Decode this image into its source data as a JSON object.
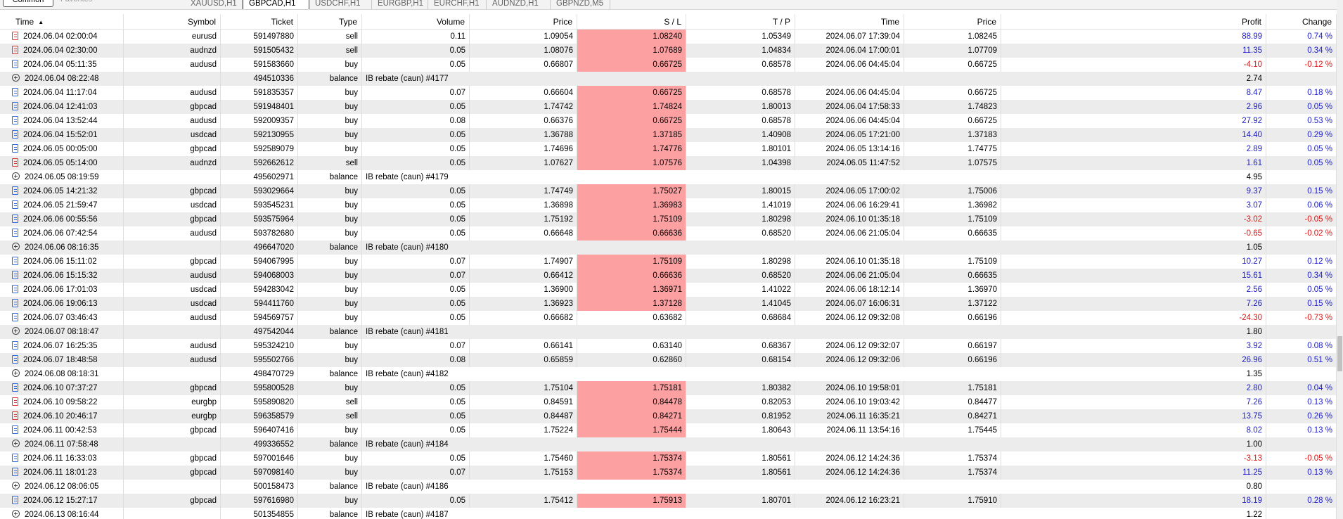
{
  "tabs": {
    "common": "Common",
    "favorites": "Favorites",
    "charts": [
      "XAUUSD,H1",
      "GBPCAD,H1",
      "USDCHF,H1",
      "EURGBP,H1",
      "EURCHF,H1",
      "AUDNZD,H1",
      "GBPNZD,M5"
    ],
    "active_index": 1
  },
  "columns": [
    "Time",
    "Symbol",
    "Ticket",
    "Type",
    "Volume",
    "Price",
    "S / L",
    "T / P",
    "Time",
    "Price",
    "Profit",
    "Change"
  ],
  "colors": {
    "sl_highlight": "#fca0a2",
    "positive": "#1a1acf",
    "negative": "#e01414",
    "stripe": "#ececec"
  },
  "rows": [
    {
      "kind": "sell",
      "time": "2024.06.04 02:00:04",
      "symbol": "eurusd",
      "ticket": "591497880",
      "type": "sell",
      "volume": "0.11",
      "price": "1.09054",
      "sl": "1.08240",
      "sl_hit": true,
      "tp": "1.05349",
      "close_time": "2024.06.07 17:39:04",
      "close_price": "1.08245",
      "profit": "88.99",
      "change": "0.74 %"
    },
    {
      "kind": "sell",
      "time": "2024.06.04 02:30:00",
      "symbol": "audnzd",
      "ticket": "591505432",
      "type": "sell",
      "volume": "0.05",
      "price": "1.08076",
      "sl": "1.07689",
      "sl_hit": true,
      "tp": "1.04834",
      "close_time": "2024.06.04 17:00:01",
      "close_price": "1.07709",
      "profit": "11.35",
      "change": "0.34 %"
    },
    {
      "kind": "buy",
      "time": "2024.06.04 05:11:35",
      "symbol": "audusd",
      "ticket": "591583660",
      "type": "buy",
      "volume": "0.05",
      "price": "0.66807",
      "sl": "0.66725",
      "sl_hit": true,
      "tp": "0.68578",
      "close_time": "2024.06.06 04:45:04",
      "close_price": "0.66725",
      "profit": "-4.10",
      "change": "-0.12 %"
    },
    {
      "kind": "balance",
      "time": "2024.06.04 08:22:48",
      "ticket": "494510336",
      "type": "balance",
      "comment": "IB rebate (caun) #4177",
      "profit": "2.74"
    },
    {
      "kind": "buy",
      "time": "2024.06.04 11:17:04",
      "symbol": "audusd",
      "ticket": "591835357",
      "type": "buy",
      "volume": "0.07",
      "price": "0.66604",
      "sl": "0.66725",
      "sl_hit": true,
      "tp": "0.68578",
      "close_time": "2024.06.06 04:45:04",
      "close_price": "0.66725",
      "profit": "8.47",
      "change": "0.18 %"
    },
    {
      "kind": "buy",
      "time": "2024.06.04 12:41:03",
      "symbol": "gbpcad",
      "ticket": "591948401",
      "type": "buy",
      "volume": "0.05",
      "price": "1.74742",
      "sl": "1.74824",
      "sl_hit": true,
      "tp": "1.80013",
      "close_time": "2024.06.04 17:58:33",
      "close_price": "1.74823",
      "profit": "2.96",
      "change": "0.05 %"
    },
    {
      "kind": "buy",
      "time": "2024.06.04 13:52:44",
      "symbol": "audusd",
      "ticket": "592009357",
      "type": "buy",
      "volume": "0.08",
      "price": "0.66376",
      "sl": "0.66725",
      "sl_hit": true,
      "tp": "0.68578",
      "close_time": "2024.06.06 04:45:04",
      "close_price": "0.66725",
      "profit": "27.92",
      "change": "0.53 %"
    },
    {
      "kind": "buy",
      "time": "2024.06.04 15:52:01",
      "symbol": "usdcad",
      "ticket": "592130955",
      "type": "buy",
      "volume": "0.05",
      "price": "1.36788",
      "sl": "1.37185",
      "sl_hit": true,
      "tp": "1.40908",
      "close_time": "2024.06.05 17:21:00",
      "close_price": "1.37183",
      "profit": "14.40",
      "change": "0.29 %"
    },
    {
      "kind": "buy",
      "time": "2024.06.05 00:05:00",
      "symbol": "gbpcad",
      "ticket": "592589079",
      "type": "buy",
      "volume": "0.05",
      "price": "1.74696",
      "sl": "1.74776",
      "sl_hit": true,
      "tp": "1.80101",
      "close_time": "2024.06.05 13:14:16",
      "close_price": "1.74775",
      "profit": "2.89",
      "change": "0.05 %"
    },
    {
      "kind": "sell",
      "time": "2024.06.05 05:14:00",
      "symbol": "audnzd",
      "ticket": "592662612",
      "type": "sell",
      "volume": "0.05",
      "price": "1.07627",
      "sl": "1.07576",
      "sl_hit": true,
      "tp": "1.04398",
      "close_time": "2024.06.05 11:47:52",
      "close_price": "1.07575",
      "profit": "1.61",
      "change": "0.05 %"
    },
    {
      "kind": "balance",
      "time": "2024.06.05 08:19:59",
      "ticket": "495602971",
      "type": "balance",
      "comment": "IB rebate (caun) #4179",
      "profit": "4.95"
    },
    {
      "kind": "buy",
      "time": "2024.06.05 14:21:32",
      "symbol": "gbpcad",
      "ticket": "593029664",
      "type": "buy",
      "volume": "0.05",
      "price": "1.74749",
      "sl": "1.75027",
      "sl_hit": true,
      "tp": "1.80015",
      "close_time": "2024.06.05 17:00:02",
      "close_price": "1.75006",
      "profit": "9.37",
      "change": "0.15 %"
    },
    {
      "kind": "buy",
      "time": "2024.06.05 21:59:47",
      "symbol": "usdcad",
      "ticket": "593545231",
      "type": "buy",
      "volume": "0.05",
      "price": "1.36898",
      "sl": "1.36983",
      "sl_hit": true,
      "tp": "1.41019",
      "close_time": "2024.06.06 16:29:41",
      "close_price": "1.36982",
      "profit": "3.07",
      "change": "0.06 %"
    },
    {
      "kind": "buy",
      "time": "2024.06.06 00:55:56",
      "symbol": "gbpcad",
      "ticket": "593575964",
      "type": "buy",
      "volume": "0.05",
      "price": "1.75192",
      "sl": "1.75109",
      "sl_hit": true,
      "tp": "1.80298",
      "close_time": "2024.06.10 01:35:18",
      "close_price": "1.75109",
      "profit": "-3.02",
      "change": "-0.05 %"
    },
    {
      "kind": "buy",
      "time": "2024.06.06 07:42:54",
      "symbol": "audusd",
      "ticket": "593782680",
      "type": "buy",
      "volume": "0.05",
      "price": "0.66648",
      "sl": "0.66636",
      "sl_hit": true,
      "tp": "0.68520",
      "close_time": "2024.06.06 21:05:04",
      "close_price": "0.66635",
      "profit": "-0.65",
      "change": "-0.02 %"
    },
    {
      "kind": "balance",
      "time": "2024.06.06 08:16:35",
      "ticket": "496647020",
      "type": "balance",
      "comment": "IB rebate (caun) #4180",
      "profit": "1.05"
    },
    {
      "kind": "buy",
      "time": "2024.06.06 15:11:02",
      "symbol": "gbpcad",
      "ticket": "594067995",
      "type": "buy",
      "volume": "0.07",
      "price": "1.74907",
      "sl": "1.75109",
      "sl_hit": true,
      "tp": "1.80298",
      "close_time": "2024.06.10 01:35:18",
      "close_price": "1.75109",
      "profit": "10.27",
      "change": "0.12 %"
    },
    {
      "kind": "buy",
      "time": "2024.06.06 15:15:32",
      "symbol": "audusd",
      "ticket": "594068003",
      "type": "buy",
      "volume": "0.07",
      "price": "0.66412",
      "sl": "0.66636",
      "sl_hit": true,
      "tp": "0.68520",
      "close_time": "2024.06.06 21:05:04",
      "close_price": "0.66635",
      "profit": "15.61",
      "change": "0.34 %"
    },
    {
      "kind": "buy",
      "time": "2024.06.06 17:01:03",
      "symbol": "usdcad",
      "ticket": "594283042",
      "type": "buy",
      "volume": "0.05",
      "price": "1.36900",
      "sl": "1.36971",
      "sl_hit": true,
      "tp": "1.41022",
      "close_time": "2024.06.06 18:12:14",
      "close_price": "1.36970",
      "profit": "2.56",
      "change": "0.05 %"
    },
    {
      "kind": "buy",
      "time": "2024.06.06 19:06:13",
      "symbol": "usdcad",
      "ticket": "594411760",
      "type": "buy",
      "volume": "0.05",
      "price": "1.36923",
      "sl": "1.37128",
      "sl_hit": true,
      "tp": "1.41045",
      "close_time": "2024.06.07 16:06:31",
      "close_price": "1.37122",
      "profit": "7.26",
      "change": "0.15 %"
    },
    {
      "kind": "buy",
      "time": "2024.06.07 03:46:43",
      "symbol": "audusd",
      "ticket": "594569757",
      "type": "buy",
      "volume": "0.05",
      "price": "0.66682",
      "sl": "0.63682",
      "sl_hit": false,
      "tp": "0.68684",
      "close_time": "2024.06.12 09:32:08",
      "close_price": "0.66196",
      "profit": "-24.30",
      "change": "-0.73 %"
    },
    {
      "kind": "balance",
      "time": "2024.06.07 08:18:47",
      "ticket": "497542044",
      "type": "balance",
      "comment": "IB rebate (caun) #4181",
      "profit": "1.80"
    },
    {
      "kind": "buy",
      "time": "2024.06.07 16:25:35",
      "symbol": "audusd",
      "ticket": "595324210",
      "type": "buy",
      "volume": "0.07",
      "price": "0.66141",
      "sl": "0.63140",
      "sl_hit": false,
      "tp": "0.68367",
      "close_time": "2024.06.12 09:32:07",
      "close_price": "0.66197",
      "profit": "3.92",
      "change": "0.08 %"
    },
    {
      "kind": "buy",
      "time": "2024.06.07 18:48:58",
      "symbol": "audusd",
      "ticket": "595502766",
      "type": "buy",
      "volume": "0.08",
      "price": "0.65859",
      "sl": "0.62860",
      "sl_hit": false,
      "tp": "0.68154",
      "close_time": "2024.06.12 09:32:06",
      "close_price": "0.66196",
      "profit": "26.96",
      "change": "0.51 %"
    },
    {
      "kind": "balance",
      "time": "2024.06.08 08:18:31",
      "ticket": "498470729",
      "type": "balance",
      "comment": "IB rebate (caun) #4182",
      "profit": "1.35"
    },
    {
      "kind": "buy",
      "time": "2024.06.10 07:37:27",
      "symbol": "gbpcad",
      "ticket": "595800528",
      "type": "buy",
      "volume": "0.05",
      "price": "1.75104",
      "sl": "1.75181",
      "sl_hit": true,
      "tp": "1.80382",
      "close_time": "2024.06.10 19:58:01",
      "close_price": "1.75181",
      "profit": "2.80",
      "change": "0.04 %"
    },
    {
      "kind": "sell",
      "time": "2024.06.10 09:58:22",
      "symbol": "eurgbp",
      "ticket": "595890820",
      "type": "sell",
      "volume": "0.05",
      "price": "0.84591",
      "sl": "0.84478",
      "sl_hit": true,
      "tp": "0.82053",
      "close_time": "2024.06.10 19:03:42",
      "close_price": "0.84477",
      "profit": "7.26",
      "change": "0.13 %"
    },
    {
      "kind": "sell",
      "time": "2024.06.10 20:46:17",
      "symbol": "eurgbp",
      "ticket": "596358579",
      "type": "sell",
      "volume": "0.05",
      "price": "0.84487",
      "sl": "0.84271",
      "sl_hit": true,
      "tp": "0.81952",
      "close_time": "2024.06.11 16:35:21",
      "close_price": "0.84271",
      "profit": "13.75",
      "change": "0.26 %"
    },
    {
      "kind": "buy",
      "time": "2024.06.11 00:42:53",
      "symbol": "gbpcad",
      "ticket": "596407416",
      "type": "buy",
      "volume": "0.05",
      "price": "1.75224",
      "sl": "1.75444",
      "sl_hit": true,
      "tp": "1.80643",
      "close_time": "2024.06.11 13:54:16",
      "close_price": "1.75445",
      "profit": "8.02",
      "change": "0.13 %"
    },
    {
      "kind": "balance",
      "time": "2024.06.11 07:58:48",
      "ticket": "499336552",
      "type": "balance",
      "comment": "IB rebate (caun) #4184",
      "profit": "1.00"
    },
    {
      "kind": "buy",
      "time": "2024.06.11 16:33:03",
      "symbol": "gbpcad",
      "ticket": "597001646",
      "type": "buy",
      "volume": "0.05",
      "price": "1.75460",
      "sl": "1.75374",
      "sl_hit": true,
      "tp": "1.80561",
      "close_time": "2024.06.12 14:24:36",
      "close_price": "1.75374",
      "profit": "-3.13",
      "change": "-0.05 %"
    },
    {
      "kind": "buy",
      "time": "2024.06.11 18:01:23",
      "symbol": "gbpcad",
      "ticket": "597098140",
      "type": "buy",
      "volume": "0.07",
      "price": "1.75153",
      "sl": "1.75374",
      "sl_hit": true,
      "tp": "1.80561",
      "close_time": "2024.06.12 14:24:36",
      "close_price": "1.75374",
      "profit": "11.25",
      "change": "0.13 %"
    },
    {
      "kind": "balance",
      "time": "2024.06.12 08:06:05",
      "ticket": "500158473",
      "type": "balance",
      "comment": "IB rebate (caun) #4186",
      "profit": "0.80"
    },
    {
      "kind": "buy",
      "time": "2024.06.12 15:27:17",
      "symbol": "gbpcad",
      "ticket": "597616980",
      "type": "buy",
      "volume": "0.05",
      "price": "1.75412",
      "sl": "1.75913",
      "sl_hit": true,
      "tp": "1.80701",
      "close_time": "2024.06.12 16:23:21",
      "close_price": "1.75910",
      "profit": "18.19",
      "change": "0.28 %"
    },
    {
      "kind": "balance",
      "time": "2024.06.13 08:16:44",
      "ticket": "501354855",
      "type": "balance",
      "comment": "IB rebate (caun) #4187",
      "profit": "1.22"
    }
  ]
}
